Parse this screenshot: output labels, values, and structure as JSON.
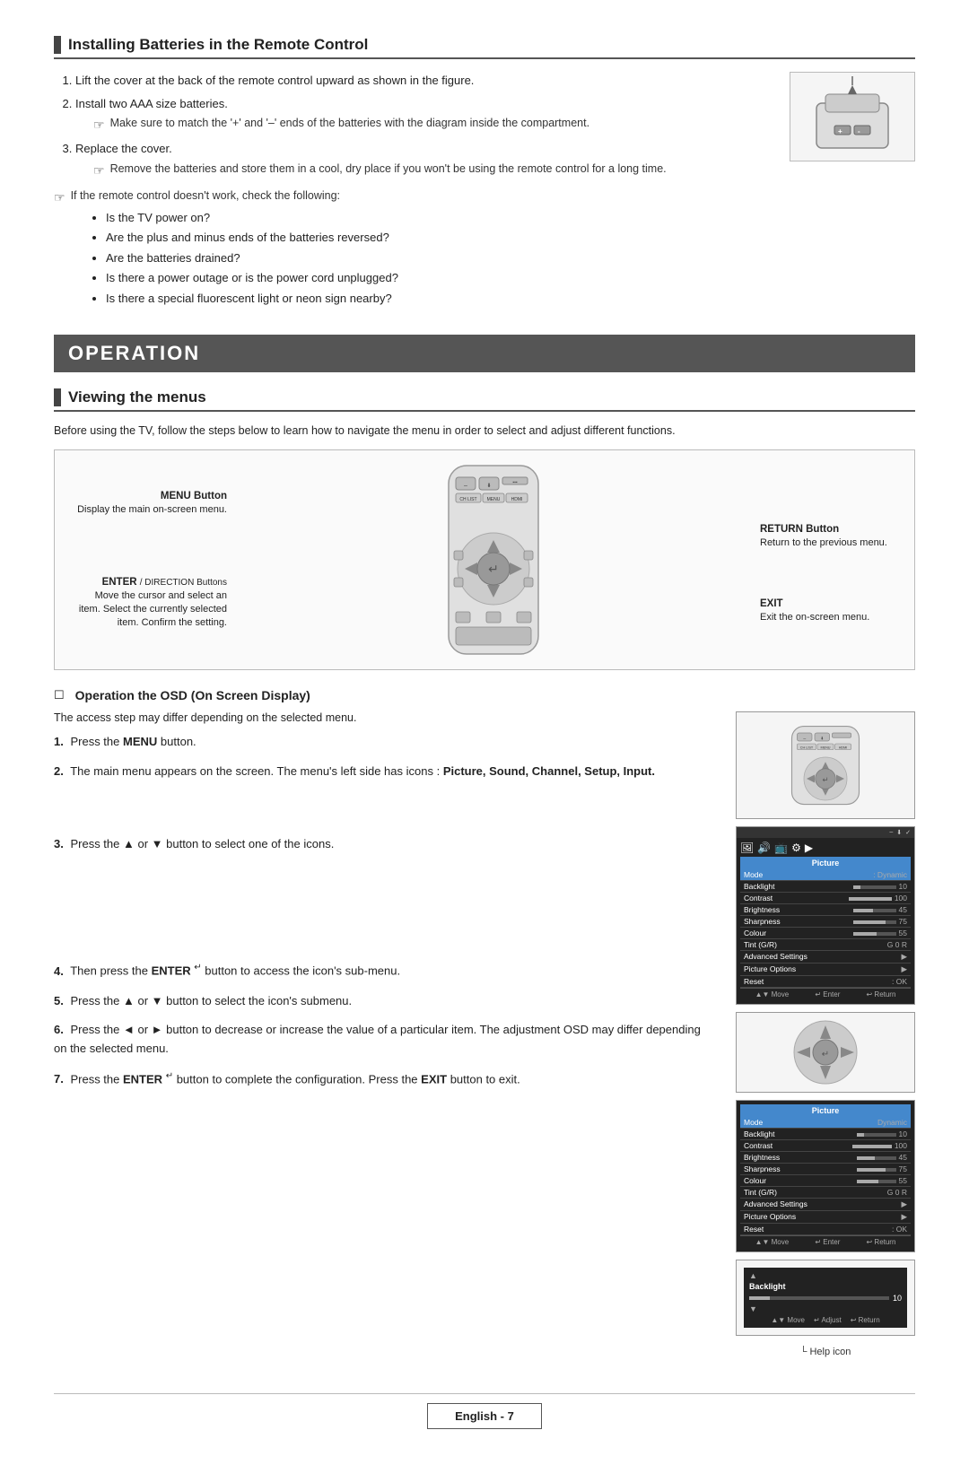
{
  "page": {
    "title": "Installing Batteries in the Remote Control",
    "operation_banner": "OPERATION",
    "viewing_menus_title": "Viewing the menus",
    "viewing_menus_intro": "Before using the TV, follow the steps below to learn how to navigate the menu in order to select and adjust different functions.",
    "footer_label": "English - 7"
  },
  "battery_steps": [
    {
      "num": "1.",
      "text": "Lift the cover at the back of the remote control upward as shown in the figure."
    },
    {
      "num": "2.",
      "text": "Install two AAA size batteries."
    },
    {
      "num": "2_note",
      "text": "Make sure to match the '+' and '–' ends of the batteries with the diagram inside the compartment."
    },
    {
      "num": "3.",
      "text": "Replace the cover."
    },
    {
      "num": "3_note",
      "text": "Remove the batteries and store them in a cool, dry place if you won't be using the remote control for a long time."
    }
  ],
  "battery_check_intro": "If the remote control doesn't work, check the following:",
  "battery_checklist": [
    "Is the TV power on?",
    "Are the plus and minus ends of the batteries reversed?",
    "Are the batteries drained?",
    "Is there a power outage or is the power cord unplugged?",
    "Is there a special fluorescent light or neon sign nearby?"
  ],
  "diagram_labels": {
    "menu_button": "MENU Button",
    "menu_button_desc": "Display the main on-screen menu.",
    "enter_button": "ENTER",
    "enter_button_suffix": " / DIRECTION Buttons",
    "enter_button_desc1": "Move the cursor and select an",
    "enter_button_desc2": "item. Select the currently selected",
    "enter_button_desc3": "item. Confirm the setting.",
    "return_button": "RETURN Button",
    "return_button_desc": "Return to the previous menu.",
    "exit_label": "EXIT",
    "exit_desc": "Exit the on-screen menu."
  },
  "osd_section": {
    "title": "Operation the OSD (On Screen Display)",
    "intro": "The access step may differ depending on the selected menu.",
    "step1": "Press the ",
    "step1_bold": "MENU",
    "step1_end": " button.",
    "step2_start": "The main menu appears on the screen. The menu's left side has icons : ",
    "step2_bold": "Picture, Sound, Channel, Setup, Input.",
    "step3": "Press the ▲ or ▼ button to select one of the icons.",
    "step4_start": "Then press the ",
    "step4_bold": "ENTER",
    "step4_end": " button to access the icon's sub-menu.",
    "step5_start": "Press the ▲ or ▼ button to select the icon's submenu.",
    "step6_start": "Press the ◄ or ► button to decrease or increase the value of a particular item. The adjustment OSD may differ depending on the selected menu.",
    "step7_start": "Press the ",
    "step7_bold1": "ENTER",
    "step7_mid": " button to complete the configuration. Press the ",
    "step7_bold2": "EXIT",
    "step7_end": " button to exit."
  },
  "tv_menu": {
    "title": "Picture",
    "rows": [
      {
        "label": "Mode",
        "value": ": Dynamic",
        "selected": true
      },
      {
        "label": "Backlight",
        "value": "10",
        "bar": true,
        "bar_pct": 10
      },
      {
        "label": "Contrast",
        "value": "100",
        "bar": true,
        "bar_pct": 100
      },
      {
        "label": "Brightness",
        "value": "45",
        "bar": true,
        "bar_pct": 45
      },
      {
        "label": "Sharpness",
        "value": "75",
        "bar": true,
        "bar_pct": 75
      },
      {
        "label": "Colour",
        "value": "55",
        "bar": true,
        "bar_pct": 55
      },
      {
        "label": "Tint (G/R)",
        "value": "G 0 R",
        "bar": false
      },
      {
        "label": "Advanced Settings",
        "value": "▶",
        "bar": false
      },
      {
        "label": "Picture Options",
        "value": "▶",
        "bar": false
      },
      {
        "label": "Reset",
        "value": ": OK",
        "bar": false
      }
    ],
    "bottom": [
      "▲▼ Move",
      "↵ Enter",
      "↩ Return"
    ]
  },
  "backlight_box": {
    "label": "Backlight",
    "value": "10",
    "bottom": [
      "▲▼ Move",
      "↵ Adjust",
      "↩ Return"
    ]
  },
  "help_icon_label": "└ Help icon"
}
